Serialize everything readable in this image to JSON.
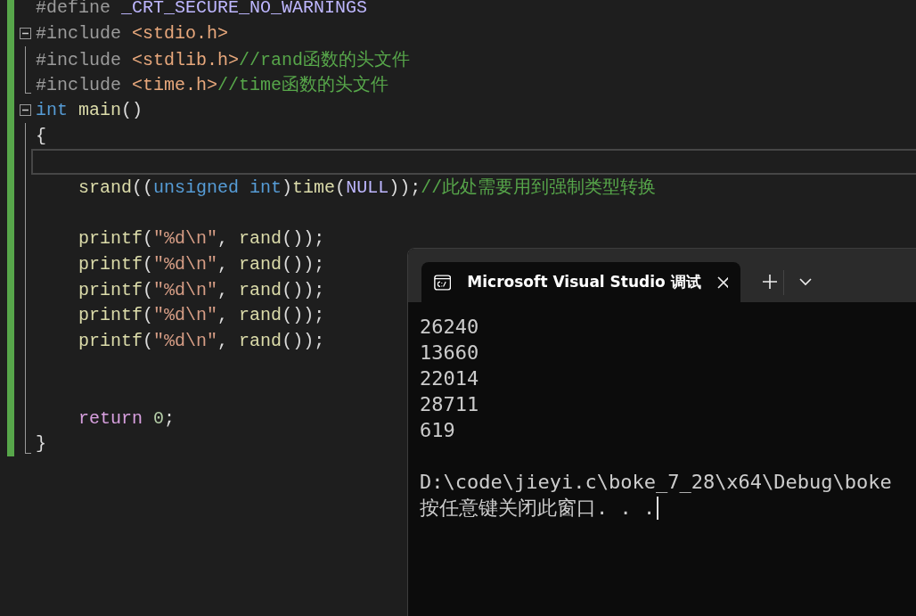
{
  "editor": {
    "lines": [
      {
        "changed": true,
        "kind": "none",
        "current": false,
        "tokens": [
          {
            "kind": "preproc",
            "text": "#define "
          },
          {
            "kind": "macro",
            "text": "_CRT_SECURE_NO_WARNINGS"
          }
        ]
      },
      {
        "changed": true,
        "kind": "start",
        "current": false,
        "tokens": [
          {
            "kind": "preproc",
            "text": "#include "
          },
          {
            "kind": "path",
            "text": "<stdio.h>"
          }
        ]
      },
      {
        "changed": true,
        "kind": "mid",
        "current": false,
        "tokens": [
          {
            "kind": "preproc",
            "text": "#include "
          },
          {
            "kind": "path",
            "text": "<stdlib.h>"
          },
          {
            "kind": "comment",
            "text": "//rand函数的头文件"
          }
        ]
      },
      {
        "changed": true,
        "kind": "end",
        "current": false,
        "tokens": [
          {
            "kind": "preproc",
            "text": "#include "
          },
          {
            "kind": "path",
            "text": "<time.h>"
          },
          {
            "kind": "comment",
            "text": "//time函数的头文件"
          }
        ]
      },
      {
        "changed": true,
        "kind": "start",
        "current": false,
        "tokens": [
          {
            "kind": "keyword",
            "text": "int"
          },
          {
            "kind": "function",
            "text": " main"
          },
          {
            "kind": "plain",
            "text": "()"
          }
        ]
      },
      {
        "changed": true,
        "kind": "mid",
        "current": false,
        "tokens": [
          {
            "kind": "plain",
            "text": "{"
          }
        ]
      },
      {
        "changed": true,
        "kind": "mid",
        "current": true
      },
      {
        "changed": true,
        "kind": "mid",
        "current": false,
        "tokens": [
          {
            "kind": "function",
            "text": "    srand"
          },
          {
            "kind": "plain",
            "text": "(("
          },
          {
            "kind": "keyword",
            "text": "unsigned int"
          },
          {
            "kind": "plain",
            "text": ")"
          },
          {
            "kind": "function",
            "text": "time"
          },
          {
            "kind": "plain",
            "text": "("
          },
          {
            "kind": "macro",
            "text": "NULL"
          },
          {
            "kind": "plain",
            "text": "));"
          },
          {
            "kind": "comment",
            "text": "//此处需要用到强制类型转换"
          }
        ]
      },
      {
        "changed": true,
        "kind": "mid",
        "current": false
      },
      {
        "changed": true,
        "kind": "mid",
        "current": false,
        "tokens": [
          {
            "kind": "function",
            "text": "    printf"
          },
          {
            "kind": "plain",
            "text": "("
          },
          {
            "kind": "string",
            "text": "\""
          },
          {
            "kind": "escape",
            "text": "%d\\n"
          },
          {
            "kind": "string",
            "text": "\""
          },
          {
            "kind": "plain",
            "text": ", "
          },
          {
            "kind": "function",
            "text": "rand"
          },
          {
            "kind": "plain",
            "text": "());"
          }
        ]
      },
      {
        "changed": true,
        "kind": "mid",
        "current": false,
        "tokens": [
          {
            "kind": "function",
            "text": "    printf"
          },
          {
            "kind": "plain",
            "text": "("
          },
          {
            "kind": "string",
            "text": "\""
          },
          {
            "kind": "escape",
            "text": "%d\\n"
          },
          {
            "kind": "string",
            "text": "\""
          },
          {
            "kind": "plain",
            "text": ", "
          },
          {
            "kind": "function",
            "text": "rand"
          },
          {
            "kind": "plain",
            "text": "());"
          }
        ]
      },
      {
        "changed": true,
        "kind": "mid",
        "current": false,
        "tokens": [
          {
            "kind": "function",
            "text": "    printf"
          },
          {
            "kind": "plain",
            "text": "("
          },
          {
            "kind": "string",
            "text": "\""
          },
          {
            "kind": "escape",
            "text": "%d\\n"
          },
          {
            "kind": "string",
            "text": "\""
          },
          {
            "kind": "plain",
            "text": ", "
          },
          {
            "kind": "function",
            "text": "rand"
          },
          {
            "kind": "plain",
            "text": "());"
          }
        ]
      },
      {
        "changed": true,
        "kind": "mid",
        "current": false,
        "tokens": [
          {
            "kind": "function",
            "text": "    printf"
          },
          {
            "kind": "plain",
            "text": "("
          },
          {
            "kind": "string",
            "text": "\""
          },
          {
            "kind": "escape",
            "text": "%d\\n"
          },
          {
            "kind": "string",
            "text": "\""
          },
          {
            "kind": "plain",
            "text": ", "
          },
          {
            "kind": "function",
            "text": "rand"
          },
          {
            "kind": "plain",
            "text": "());"
          }
        ]
      },
      {
        "changed": true,
        "kind": "mid",
        "current": false,
        "tokens": [
          {
            "kind": "function",
            "text": "    printf"
          },
          {
            "kind": "plain",
            "text": "("
          },
          {
            "kind": "string",
            "text": "\""
          },
          {
            "kind": "escape",
            "text": "%d\\n"
          },
          {
            "kind": "string",
            "text": "\""
          },
          {
            "kind": "plain",
            "text": ", "
          },
          {
            "kind": "function",
            "text": "rand"
          },
          {
            "kind": "plain",
            "text": "());"
          }
        ]
      },
      {
        "changed": true,
        "kind": "mid",
        "current": false
      },
      {
        "changed": true,
        "kind": "mid",
        "current": false
      },
      {
        "changed": true,
        "kind": "mid",
        "current": false,
        "tokens": [
          {
            "kind": "control",
            "text": "    return"
          },
          {
            "kind": "number",
            "text": " 0"
          },
          {
            "kind": "plain",
            "text": ";"
          }
        ]
      },
      {
        "changed": true,
        "kind": "end",
        "current": false,
        "tokens": [
          {
            "kind": "plain",
            "text": "}"
          }
        ]
      }
    ]
  },
  "terminal": {
    "tab": {
      "title": "Microsoft Visual Studio 调试",
      "selected": true
    },
    "blocks": [
      [
        "26240",
        "13660",
        "22014",
        "28711",
        "619"
      ],
      [
        "D:\\code\\jieyi.c\\boke_7_28\\x64\\Debug\\boke",
        "按任意键关闭此窗口. . ."
      ]
    ]
  }
}
